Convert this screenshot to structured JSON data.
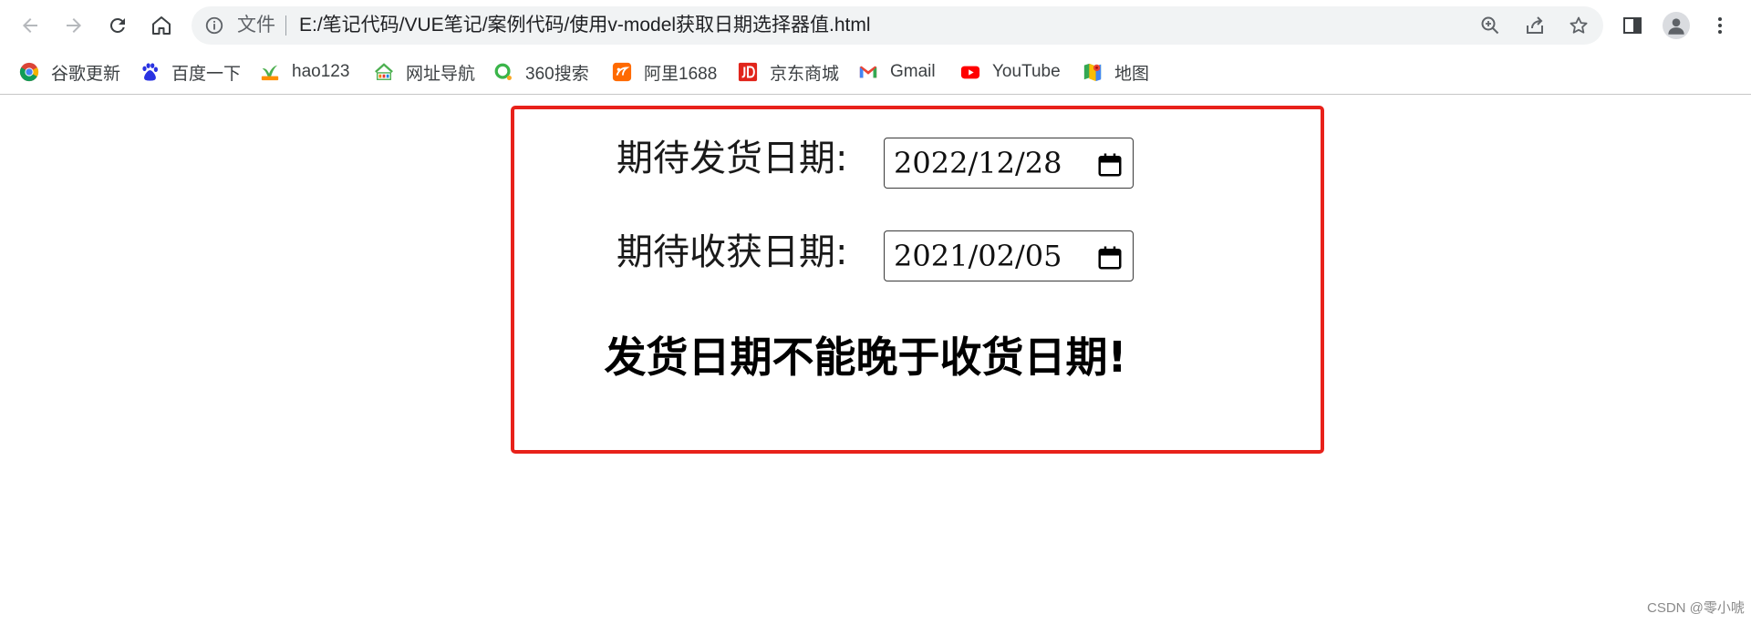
{
  "browser": {
    "omnibox": {
      "chip_label": "文件",
      "url": "E:/笔记代码/VUE笔记/案例代码/使用v-model获取日期选择器值.html"
    }
  },
  "bookmarks": [
    {
      "label": "谷歌更新",
      "icon": "chrome-icon"
    },
    {
      "label": "百度一下",
      "icon": "baidu-paw-icon"
    },
    {
      "label": "hao123",
      "icon": "hao123-icon"
    },
    {
      "label": "网址导航",
      "icon": "2345-icon"
    },
    {
      "label": "360搜索",
      "icon": "360-search-icon"
    },
    {
      "label": "阿里1688",
      "icon": "alibaba-1688-icon"
    },
    {
      "label": "京东商城",
      "icon": "jd-icon"
    },
    {
      "label": "Gmail",
      "icon": "gmail-icon"
    },
    {
      "label": "YouTube",
      "icon": "youtube-icon"
    },
    {
      "label": "地图",
      "icon": "maps-icon"
    }
  ],
  "page": {
    "ship_label": "期待发货日期:",
    "ship_date": "2022/12/28",
    "receive_label": "期待收获日期:",
    "receive_date": "2021/02/05",
    "warning": "发货日期不能晚于收货日期!"
  },
  "watermark": "CSDN @零小唬",
  "colors": {
    "panel_border": "#e8211a",
    "omnibox_bg": "#f1f3f4"
  }
}
